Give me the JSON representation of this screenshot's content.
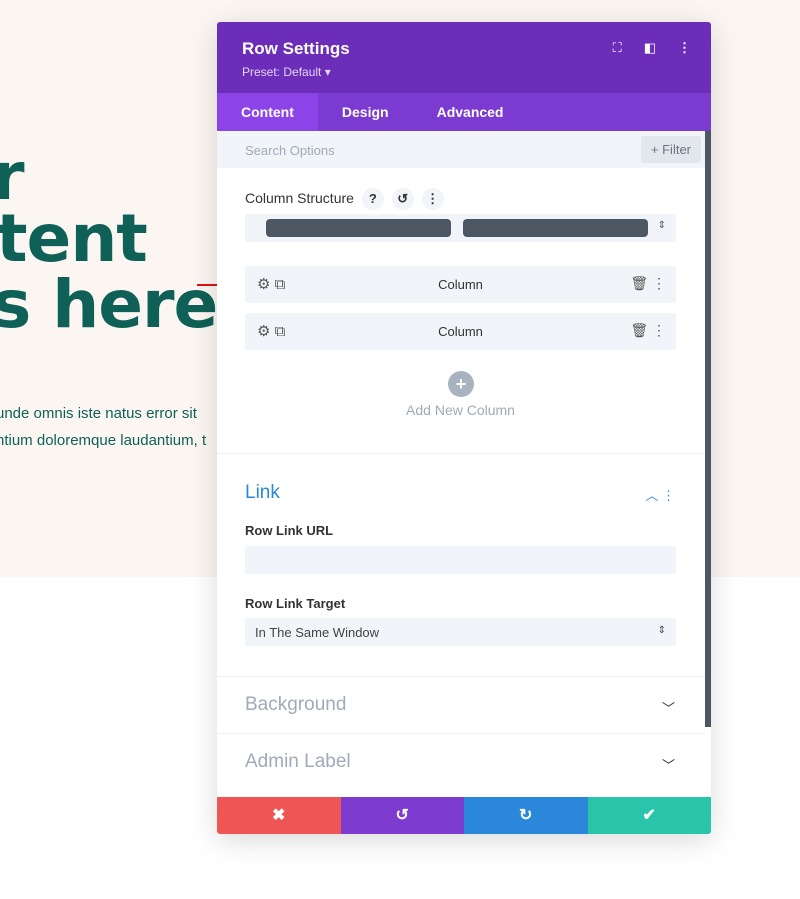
{
  "background_page": {
    "headline_lines": [
      "r",
      "tent",
      "s here."
    ],
    "paragraph_lines": [
      "unde omnis iste natus error sit",
      "ntium doloremque laudantium, t"
    ]
  },
  "modal": {
    "title": "Row Settings",
    "preset": "Preset: Default ▾",
    "tabs": [
      {
        "label": "Content",
        "active": true
      },
      {
        "label": "Design"
      },
      {
        "label": "Advanced"
      }
    ],
    "search": {
      "placeholder": "Search Options",
      "filter_label": "+ Filter"
    },
    "column_structure": {
      "label": "Column Structure",
      "help": "?",
      "reset": "↺",
      "more": "⋮"
    },
    "columns": [
      {
        "label": "Column"
      },
      {
        "label": "Column"
      }
    ],
    "add_column_label": "Add New Column",
    "link": {
      "title": "Link",
      "url_label": "Row Link URL",
      "url_value": "",
      "target_label": "Row Link Target",
      "target_value": "In The Same Window"
    },
    "sections": [
      {
        "title": "Background"
      },
      {
        "title": "Admin Label"
      }
    ],
    "footer": {
      "cancel": "✖",
      "undo": "↺",
      "redo": "↻",
      "save": "✔"
    },
    "colors": {
      "header": "#6c2eb9",
      "tabs": "#7b3bd0",
      "cancel": "#ef5555",
      "undo": "#7e3bd0",
      "redo": "#2b87da",
      "save": "#29c4a9",
      "link_title": "#2b87da"
    }
  }
}
